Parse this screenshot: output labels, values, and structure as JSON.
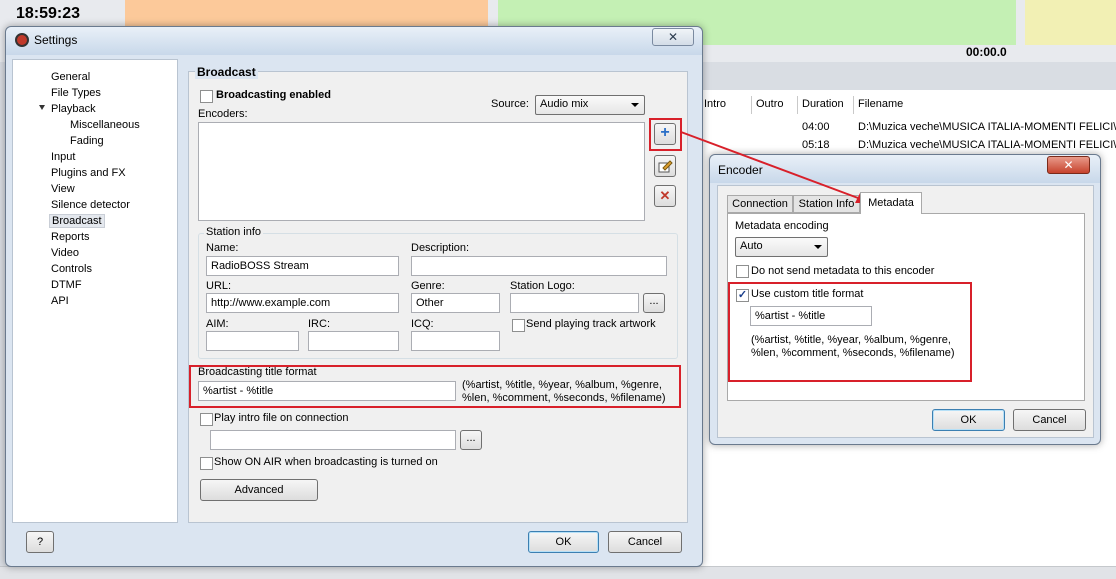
{
  "background_app": {
    "clock": "18:59:23",
    "timer": "00:00.0",
    "columns": [
      "Intro",
      "Outro",
      "Duration",
      "Filename"
    ],
    "rows": [
      {
        "duration": "04:00",
        "filename": "D:\\Muzica veche\\MUSICA ITALIA-MOMENTI FELICI\\Ri"
      },
      {
        "duration": "05:18",
        "filename": "D:\\Muzica veche\\MUSICA ITALIA-MOMENTI FELICI\\Lu"
      }
    ]
  },
  "settings": {
    "title": "Settings",
    "close_icon": "✕",
    "tree": [
      "General",
      "File Types",
      "Playback",
      "Miscellaneous",
      "Fading",
      "Input",
      "Plugins and FX",
      "View",
      "Silence detector",
      "Broadcast",
      "Reports",
      "Video",
      "Controls",
      "DTMF",
      "API"
    ],
    "page_title": "Broadcast",
    "broadcasting_enabled_label": "Broadcasting enabled",
    "source_label": "Source:",
    "source_value": "Audio mix",
    "encoders_label": "Encoders:",
    "station_info": {
      "group_label": "Station info",
      "name_label": "Name:",
      "name_value": "RadioBOSS Stream",
      "description_label": "Description:",
      "description_value": "",
      "url_label": "URL:",
      "url_value": "http://www.example.com",
      "genre_label": "Genre:",
      "genre_value": "Other",
      "logo_label": "Station Logo:",
      "logo_value": "",
      "aim_label": "AIM:",
      "irc_label": "IRC:",
      "icq_label": "ICQ:",
      "artwork_label": "Send playing track artwork",
      "browse_label": "..."
    },
    "title_format": {
      "label": "Broadcasting title format",
      "value": "%artist - %title",
      "hint_line1": "(%artist, %title, %year, %album, %genre,",
      "hint_line2": "%len, %comment, %seconds, %filename)"
    },
    "intro_label": "Play intro file on connection",
    "intro_value": "",
    "onair_label": "Show ON AIR when broadcasting is turned on",
    "advanced_label": "Advanced",
    "help_label": "?",
    "ok_label": "OK",
    "cancel_label": "Cancel",
    "add_icon": "+",
    "delete_icon": "✕"
  },
  "encoder": {
    "title": "Encoder",
    "close_icon": "✕",
    "tabs": [
      "Connection",
      "Station Info",
      "Metadata"
    ],
    "metadata_encoding_label": "Metadata encoding",
    "metadata_encoding_value": "Auto",
    "no_metadata_label": "Do not send metadata to this encoder",
    "custom_title_label": "Use custom title format",
    "custom_title_check": "✓",
    "custom_title_value": "%artist - %title",
    "hint_line1": "(%artist, %title, %year, %album, %genre,",
    "hint_line2": "%len, %comment, %seconds, %filename)",
    "ok_label": "OK",
    "cancel_label": "Cancel"
  },
  "colors": {
    "highlight": "#d8202a",
    "add_icon": "#2a6fc7",
    "delete_icon": "#c0392b"
  }
}
